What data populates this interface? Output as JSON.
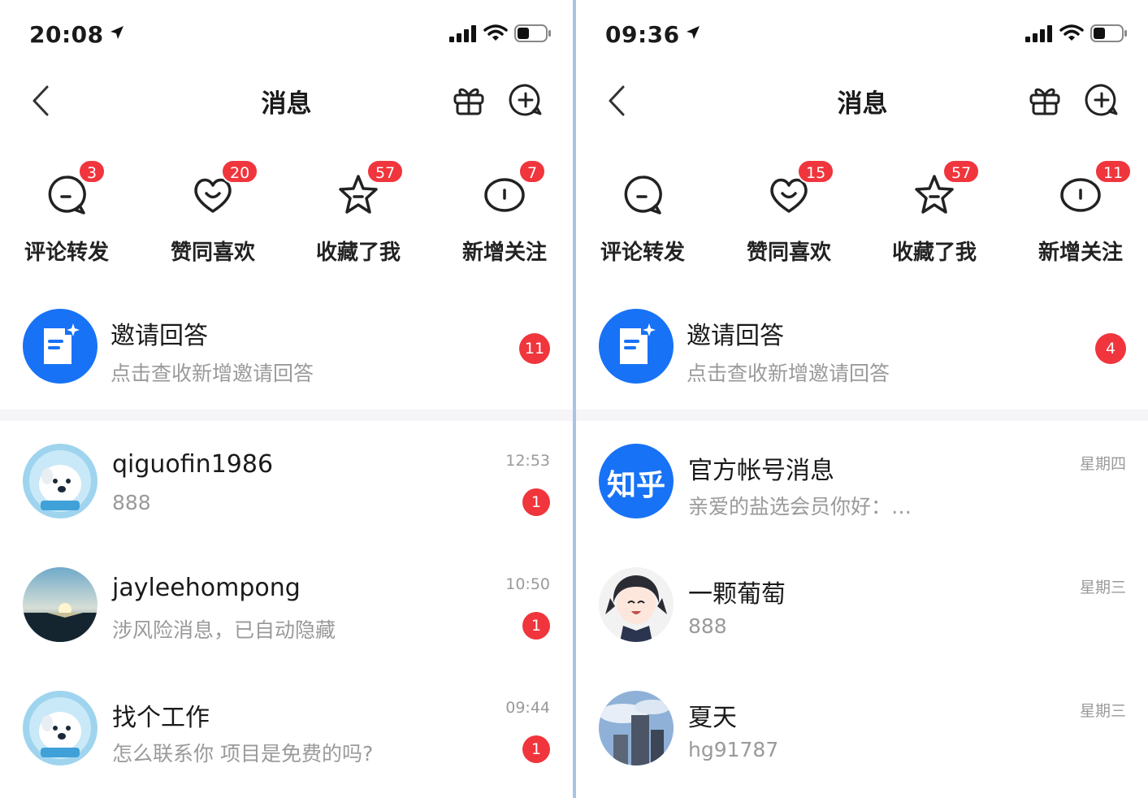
{
  "colors": {
    "accent": "#1772f6",
    "badge": "#f0353d",
    "secondary_text": "#9a9a9a",
    "divider": "#a9c3e4"
  },
  "panels": [
    {
      "status": {
        "time": "20:08"
      },
      "nav": {
        "title": "消息",
        "back_icon": "chevron-left-icon",
        "gift_icon": "gift-icon",
        "add_icon": "add-chat-icon"
      },
      "categories": [
        {
          "label": "评论转发",
          "badge": "3",
          "icon": "comment-icon"
        },
        {
          "label": "赞同喜欢",
          "badge": "20",
          "icon": "heart-icon"
        },
        {
          "label": "收藏了我",
          "badge": "57",
          "icon": "star-icon"
        },
        {
          "label": "新增关注",
          "badge": "7",
          "icon": "follow-icon"
        }
      ],
      "invite": {
        "title": "邀请回答",
        "subtitle": "点击查收新增邀请回答",
        "count": "11",
        "icon": "document-sparkle-icon"
      },
      "messages": [
        {
          "name": "qiguofin1986",
          "preview": "888",
          "time": "12:53",
          "unread": "1",
          "avatar": "dog-avatar"
        },
        {
          "name": "jayleehompong",
          "preview": "涉风险消息，已自动隐藏",
          "time": "10:50",
          "unread": "1",
          "avatar": "sunset-avatar"
        },
        {
          "name": "找个工作",
          "preview": "怎么联系你 项目是免费的吗?",
          "time": "09:44",
          "unread": "1",
          "avatar": "dog-avatar"
        }
      ]
    },
    {
      "status": {
        "time": "09:36"
      },
      "nav": {
        "title": "消息",
        "back_icon": "chevron-left-icon",
        "gift_icon": "gift-icon",
        "add_icon": "add-chat-icon"
      },
      "categories": [
        {
          "label": "评论转发",
          "badge": "",
          "icon": "comment-icon"
        },
        {
          "label": "赞同喜欢",
          "badge": "15",
          "icon": "heart-icon"
        },
        {
          "label": "收藏了我",
          "badge": "57",
          "icon": "star-icon"
        },
        {
          "label": "新增关注",
          "badge": "11",
          "icon": "follow-icon"
        }
      ],
      "invite": {
        "title": "邀请回答",
        "subtitle": "点击查收新增邀请回答",
        "count": "4",
        "icon": "document-sparkle-icon"
      },
      "messages": [
        {
          "name": "官方帐号消息",
          "preview": "亲爱的盐选会员你好：…",
          "time": "星期四",
          "unread": "",
          "avatar": "zhihu-logo",
          "logo_text": "知乎"
        },
        {
          "name": "一颗葡萄",
          "preview": "888",
          "time": "星期三",
          "unread": "",
          "avatar": "anime-girl-avatar"
        },
        {
          "name": "夏天",
          "preview": "hg91787",
          "time": "星期三",
          "unread": "",
          "avatar": "building-avatar"
        }
      ]
    }
  ]
}
